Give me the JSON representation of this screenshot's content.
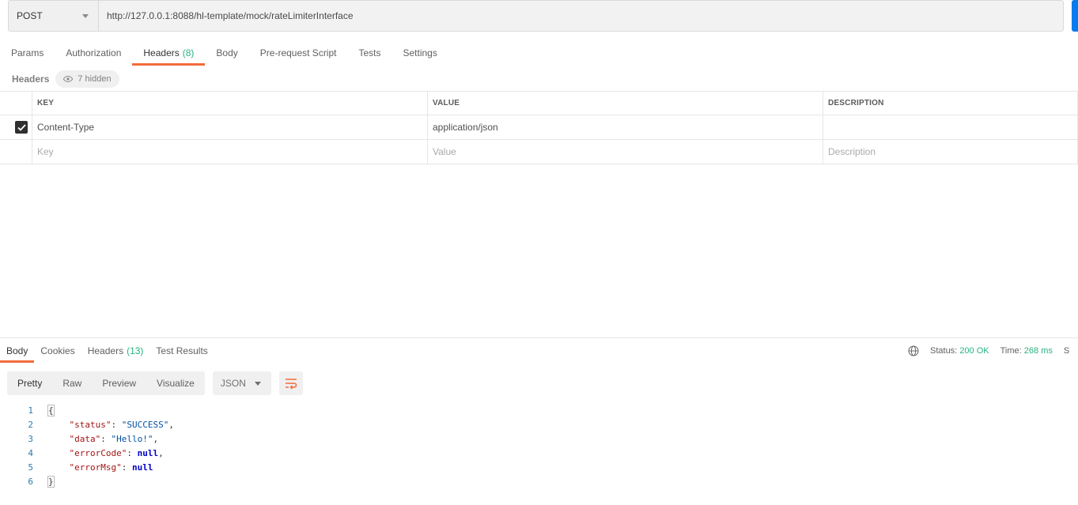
{
  "request": {
    "method": "POST",
    "url": "http://127.0.0.1:8088/hl-template/mock/rateLimiterInterface"
  },
  "request_tabs": [
    {
      "label": "Params",
      "count": ""
    },
    {
      "label": "Authorization",
      "count": ""
    },
    {
      "label": "Headers",
      "count": "(8)"
    },
    {
      "label": "Body",
      "count": ""
    },
    {
      "label": "Pre-request Script",
      "count": ""
    },
    {
      "label": "Tests",
      "count": ""
    },
    {
      "label": "Settings",
      "count": ""
    }
  ],
  "headers_section": {
    "label": "Headers",
    "hidden": "7 hidden",
    "columns": {
      "key": "KEY",
      "value": "VALUE",
      "description": "DESCRIPTION"
    },
    "rows": [
      {
        "key": "Content-Type",
        "value": "application/json",
        "description": "",
        "checked": true
      }
    ],
    "placeholders": {
      "key": "Key",
      "value": "Value",
      "description": "Description"
    }
  },
  "response_tabs": [
    {
      "label": "Body",
      "count": ""
    },
    {
      "label": "Cookies",
      "count": ""
    },
    {
      "label": "Headers",
      "count": "(13)"
    },
    {
      "label": "Test Results",
      "count": ""
    }
  ],
  "response_status": {
    "status_label": "Status:",
    "status_value": "200 OK",
    "time_label": "Time:",
    "time_value": "268 ms",
    "size_label_partial": "S"
  },
  "view_modes": [
    "Pretty",
    "Raw",
    "Preview",
    "Visualize"
  ],
  "format": "JSON",
  "code": {
    "line_numbers": [
      "1",
      "2",
      "3",
      "4",
      "5",
      "6"
    ],
    "open_brace": "{",
    "close_brace": "}",
    "fields": [
      {
        "key": "\"status\"",
        "value": "\"SUCCESS\"",
        "type": "string",
        "comma": ","
      },
      {
        "key": "\"data\"",
        "value": "\"Hello!\"",
        "type": "string",
        "comma": ","
      },
      {
        "key": "\"errorCode\"",
        "value": "null",
        "type": "null",
        "comma": ","
      },
      {
        "key": "\"errorMsg\"",
        "value": "null",
        "type": "null",
        "comma": ""
      }
    ]
  },
  "colors": {
    "accent": "#f26b3a",
    "success": "#26b47f",
    "send": "#097bed"
  }
}
